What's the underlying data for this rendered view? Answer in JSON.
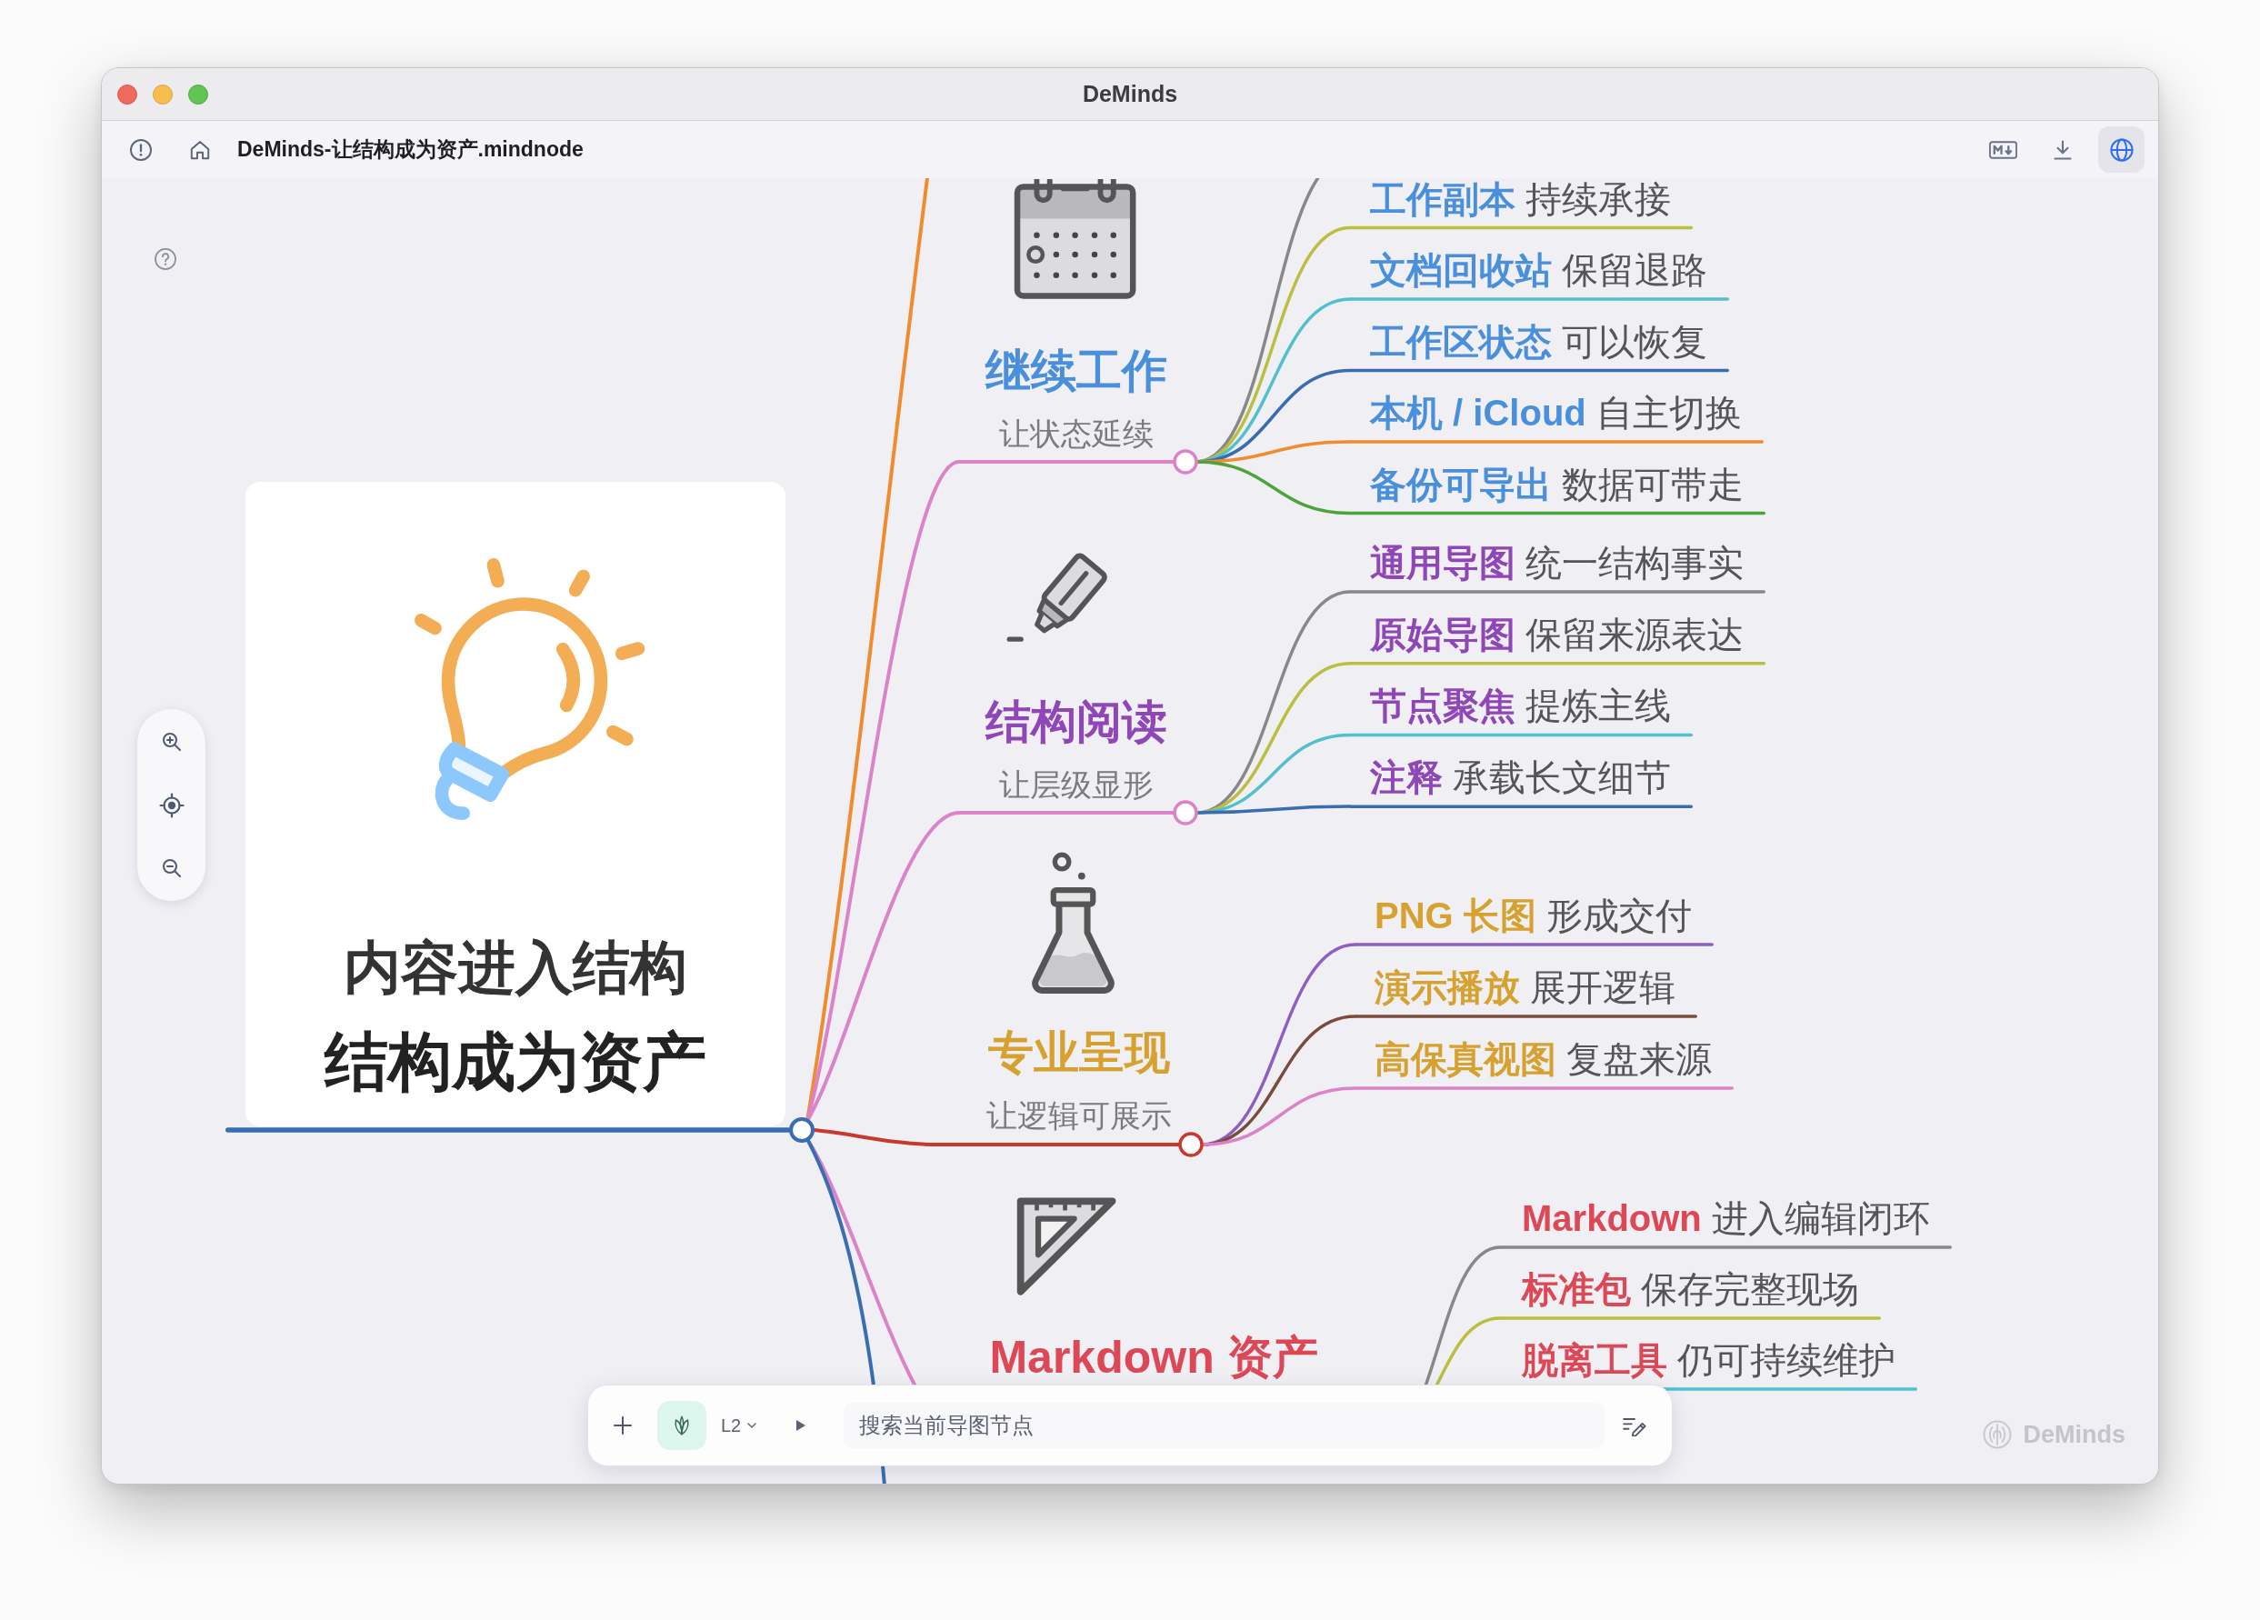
{
  "window": {
    "title": "DeMinds"
  },
  "toolbar": {
    "document": "DeMinds-让结构成为资产.mindnode",
    "buttons": [
      {
        "selected": false
      },
      {
        "selected": false
      },
      {
        "selected": true
      }
    ]
  },
  "mindmap": {
    "root": {
      "lines": [
        "内容进入结构",
        "结构成为资产"
      ]
    },
    "connectors": [
      {
        "color": "#f08c2e"
      },
      {
        "color": "#db82c9"
      },
      {
        "color": "#db82c9"
      },
      {
        "color": "#c8382e"
      },
      {
        "color": "#db82c9"
      },
      {
        "color": "#3b6db1"
      }
    ],
    "branches": [
      {
        "title": "继续工作",
        "subtitle": "让状态延续",
        "color": "#4a8fdc",
        "children": [
          {
            "color": "#888888"
          },
          {
            "label": "**工作副本** 持续承接",
            "color": "#bcbe3f"
          },
          {
            "label": "**文档回收站** 保留退路",
            "color": "#52bfcf"
          },
          {
            "label": "**工作区状态** 可以恢复",
            "color": "#3a6db0"
          },
          {
            "label": "**本机 / iCloud** 自主切换",
            "color": "#f08c2e"
          },
          {
            "label": "**备份可导出** 数据可带走",
            "color": "#4ea33b"
          }
        ]
      },
      {
        "title": "结构阅读",
        "subtitle": "让层级显形",
        "color": "#8f47b8",
        "children": [
          {
            "label": "**通用导图** 统一结构事实",
            "color": "#888888"
          },
          {
            "label": "**原始导图** 保留来源表达",
            "color": "#bcbe3f"
          },
          {
            "label": "**节点聚焦** 提炼主线",
            "color": "#52bfcf"
          },
          {
            "label": "**注释** 承载长文细节",
            "color": "#3a6db0"
          }
        ]
      },
      {
        "title": "专业呈现",
        "subtitle": "让逻辑可展示",
        "color": "#d6a12f",
        "children": [
          {
            "label": "**PNG 长图** 形成交付",
            "color": "#8d5fc4"
          },
          {
            "label": "**演示播放** 展开逻辑",
            "color": "#7b4b3c"
          },
          {
            "label": "**高保真视图** 复盘来源",
            "color": "#db82c9"
          }
        ]
      },
      {
        "title": "Markdown 资产",
        "color": "#dc4856",
        "children": [
          {
            "label": "**Markdown** 进入编辑闭环",
            "color": "#888888"
          },
          {
            "label": "**标准包** 保存完整现场",
            "color": "#bcbe3f"
          },
          {
            "label": "**脱离工具** 仍可持续维护",
            "color": "#52bfcf"
          }
        ]
      }
    ]
  },
  "bottom_bar": {
    "depth_button": "L2",
    "search": {
      "placeholder": "搜索当前导图节点"
    }
  },
  "canvas_brand": "DeMinds"
}
